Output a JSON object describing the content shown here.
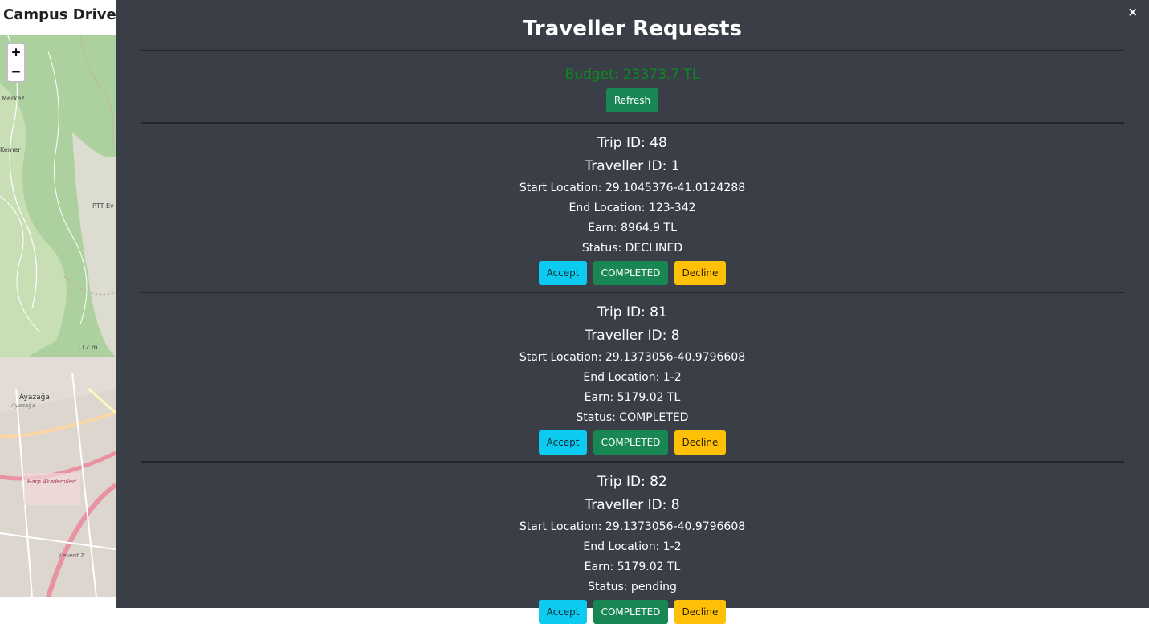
{
  "app": {
    "title": "Campus Driver |"
  },
  "map": {
    "zoom_in": "+",
    "zoom_out": "−",
    "labels": {
      "merkez": "Merkez",
      "kemer": "Kemer",
      "ptt": "PTT Ev",
      "elevation": "112 m",
      "ayazaga": "Ayazağa",
      "ayazaga_sub": "Ayazağa",
      "harp": "Harp Akademileri",
      "levent": "Levent 2"
    }
  },
  "modal": {
    "close": "×",
    "title": "Traveller Requests",
    "budget": "Budget: 23373.7 TL",
    "refresh_label": "Refresh",
    "trips": [
      {
        "trip_id": "Trip ID: 48",
        "traveller_id": "Traveller ID: 1",
        "start": "Start Location: 29.1045376-41.0124288",
        "end": "End Location: 123-342",
        "earn": "Earn: 8964.9 TL",
        "status": "Status: DECLINED",
        "accept_label": "Accept",
        "complete_label": "COMPLETED",
        "decline_label": "Decline"
      },
      {
        "trip_id": "Trip ID: 81",
        "traveller_id": "Traveller ID: 8",
        "start": "Start Location: 29.1373056-40.9796608",
        "end": "End Location: 1-2",
        "earn": "Earn: 5179.02 TL",
        "status": "Status: COMPLETED",
        "accept_label": "Accept",
        "complete_label": "COMPLETED",
        "decline_label": "Decline"
      },
      {
        "trip_id": "Trip ID: 82",
        "traveller_id": "Traveller ID: 8",
        "start": "Start Location: 29.1373056-40.9796608",
        "end": "End Location: 1-2",
        "earn": "Earn: 5179.02 TL",
        "status": "Status: pending",
        "accept_label": "Accept",
        "complete_label": "COMPLETED",
        "decline_label": "Decline"
      }
    ]
  },
  "colors": {
    "overlay_bg": "#3a3f47",
    "budget": "#0a8a1f",
    "accept": "#0dcaf0",
    "completed": "#198754",
    "decline": "#ffc107"
  }
}
